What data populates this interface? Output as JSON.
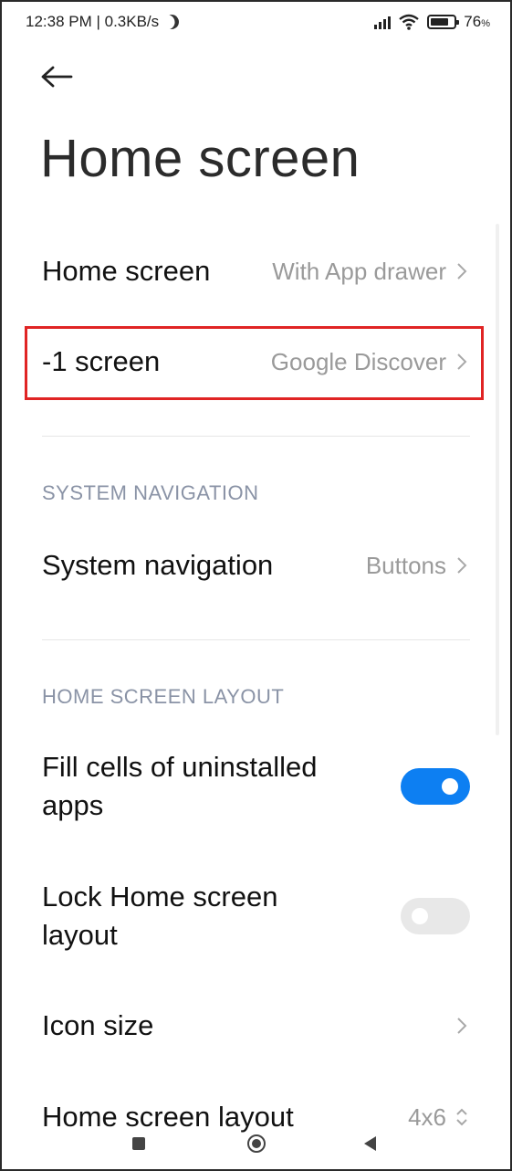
{
  "status_bar": {
    "time_speed": "12:38 PM | 0.3KB/s",
    "battery": "76",
    "battery_suffix": "%"
  },
  "header": {
    "title": "Home screen"
  },
  "settings": {
    "home_screen": {
      "label": "Home screen",
      "value": "With App drawer"
    },
    "minus_one_screen": {
      "label": "-1 screen",
      "value": "Google Discover"
    },
    "section_system_navigation": "SYSTEM NAVIGATION",
    "system_navigation": {
      "label": "System navigation",
      "value": "Buttons"
    },
    "section_home_screen_layout": "HOME SCREEN LAYOUT",
    "fill_cells": {
      "label_line1": "Fill cells of uninstalled",
      "label_line2": "apps",
      "enabled": true
    },
    "lock_layout": {
      "label_line1": "Lock Home screen",
      "label_line2": "layout",
      "enabled": false
    },
    "icon_size": {
      "label": "Icon size"
    },
    "home_screen_layout": {
      "label": "Home screen layout",
      "value": "4x6"
    }
  },
  "colors": {
    "accent": "#0d7ff2",
    "highlight": "#e02424",
    "section_text": "#8a93a6"
  }
}
